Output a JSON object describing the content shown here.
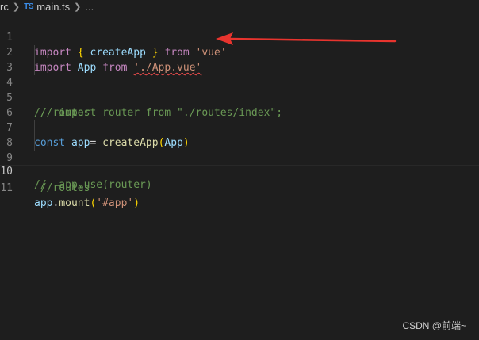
{
  "breadcrumb": {
    "folder": "rc",
    "file_badge": "TS",
    "file_name": "main.ts",
    "ellipsis": "..."
  },
  "editor": {
    "lines": [
      {
        "number": "1"
      },
      {
        "number": "2"
      },
      {
        "number": "3"
      },
      {
        "number": "4"
      },
      {
        "number": "5"
      },
      {
        "number": "6"
      },
      {
        "number": "7"
      },
      {
        "number": "8"
      },
      {
        "number": "9"
      },
      {
        "number": "10"
      },
      {
        "number": "11"
      }
    ],
    "tokens": {
      "import": "import",
      "from": "from",
      "const": "const",
      "open_brace": "{",
      "close_brace": "}",
      "createApp": "createApp",
      "App": "App",
      "vue_str": "'vue'",
      "app_vue_str": "'./App.vue'",
      "routes_comment_4": "//routes",
      "import_router_comment": "//  import router from \"./routes/index\";",
      "app_var": "app",
      "eq": "=",
      "open_paren": "(",
      "close_paren": ")",
      "routes_comment_9": "//routes",
      "app_use_comment": "//  app.use(router)",
      "mount": "mount",
      "dot": ".",
      "app_str": "'#app'"
    }
  },
  "watermark": {
    "text": "CSDN @前端~"
  },
  "colors": {
    "background": "#1e1e1e",
    "keyword": "#c586c0",
    "storage": "#569cd6",
    "variable": "#9cdcfe",
    "function": "#dcdcaa",
    "string": "#ce9178",
    "comment": "#6a9955",
    "annotation_arrow": "#e8342e"
  },
  "annotation": {
    "icon": "red-arrow-icon"
  }
}
